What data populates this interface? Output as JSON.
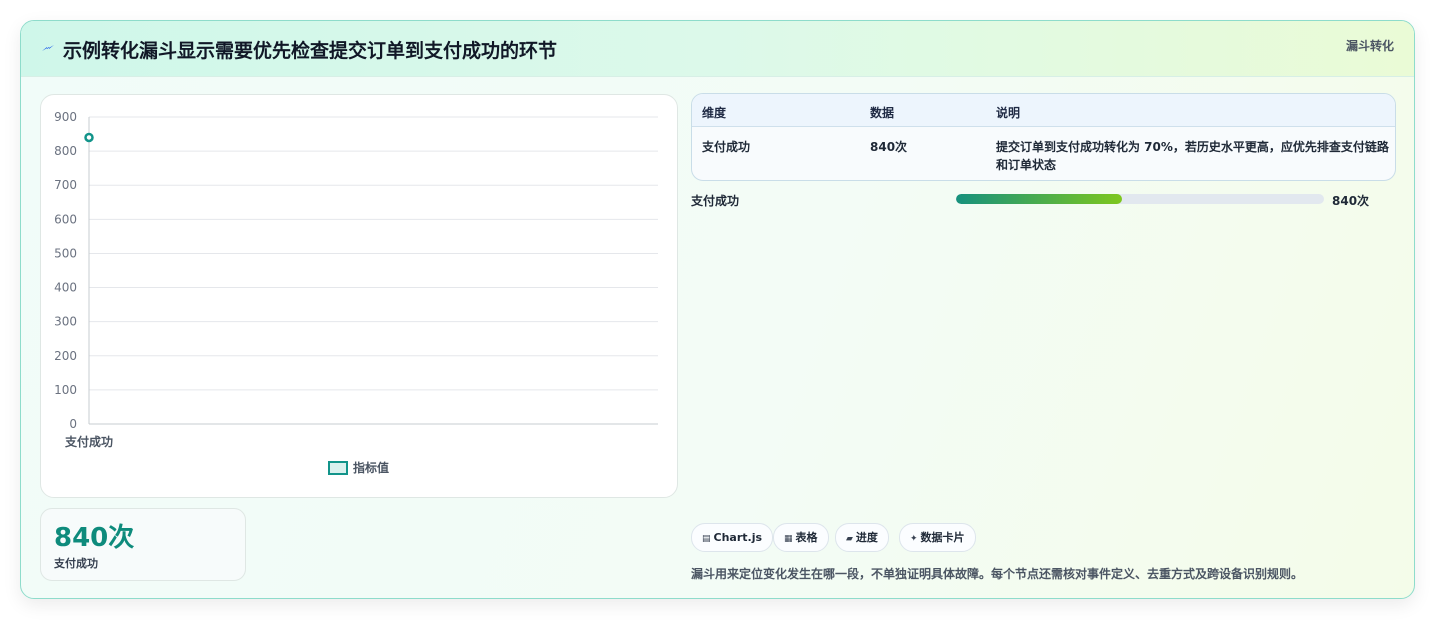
{
  "header": {
    "icon": "lightning-icon",
    "title": "示例转化漏斗显示需要优先检查提交订单到支付成功的环节",
    "tag": "漏斗转化"
  },
  "chart_data": {
    "type": "line",
    "categories": [
      "支付成功"
    ],
    "series": [
      {
        "name": "指标值",
        "values": [
          840
        ]
      }
    ],
    "ylim": [
      0,
      900
    ],
    "yticks": [
      0,
      100,
      200,
      300,
      400,
      500,
      600,
      700,
      800,
      900
    ],
    "legend": "bottom",
    "grid": true,
    "colors": {
      "series": "#12948a",
      "grid": "#e5e7eb",
      "axis": "#c7ccd1"
    }
  },
  "kpi": {
    "value": "840次",
    "label": "支付成功"
  },
  "table": {
    "headers": [
      "维度",
      "数据",
      "说明"
    ],
    "rows": [
      {
        "dimension": "支付成功",
        "data": "840次",
        "desc_line1": "提交订单到支付成功转化为 70%，若历史水平更高，应优先排查支付链路",
        "desc_line2": "和订单状态"
      }
    ]
  },
  "progress": {
    "label": "支付成功",
    "value_text": "840次",
    "fill_fraction": 0.45
  },
  "chips": [
    {
      "icon": "chart-icon",
      "glyph": "▤",
      "label": "Chart.js"
    },
    {
      "icon": "table-icon",
      "glyph": "▦",
      "label": "表格"
    },
    {
      "icon": "progress-icon",
      "glyph": "▰",
      "label": "进度"
    },
    {
      "icon": "sparkle-icon",
      "glyph": "✦",
      "label": "数据卡片"
    }
  ],
  "note": "漏斗用来定位变化发生在哪一段，不单独证明具体故障。每个节点还需核对事件定义、去重方式及跨设备识别规则。"
}
